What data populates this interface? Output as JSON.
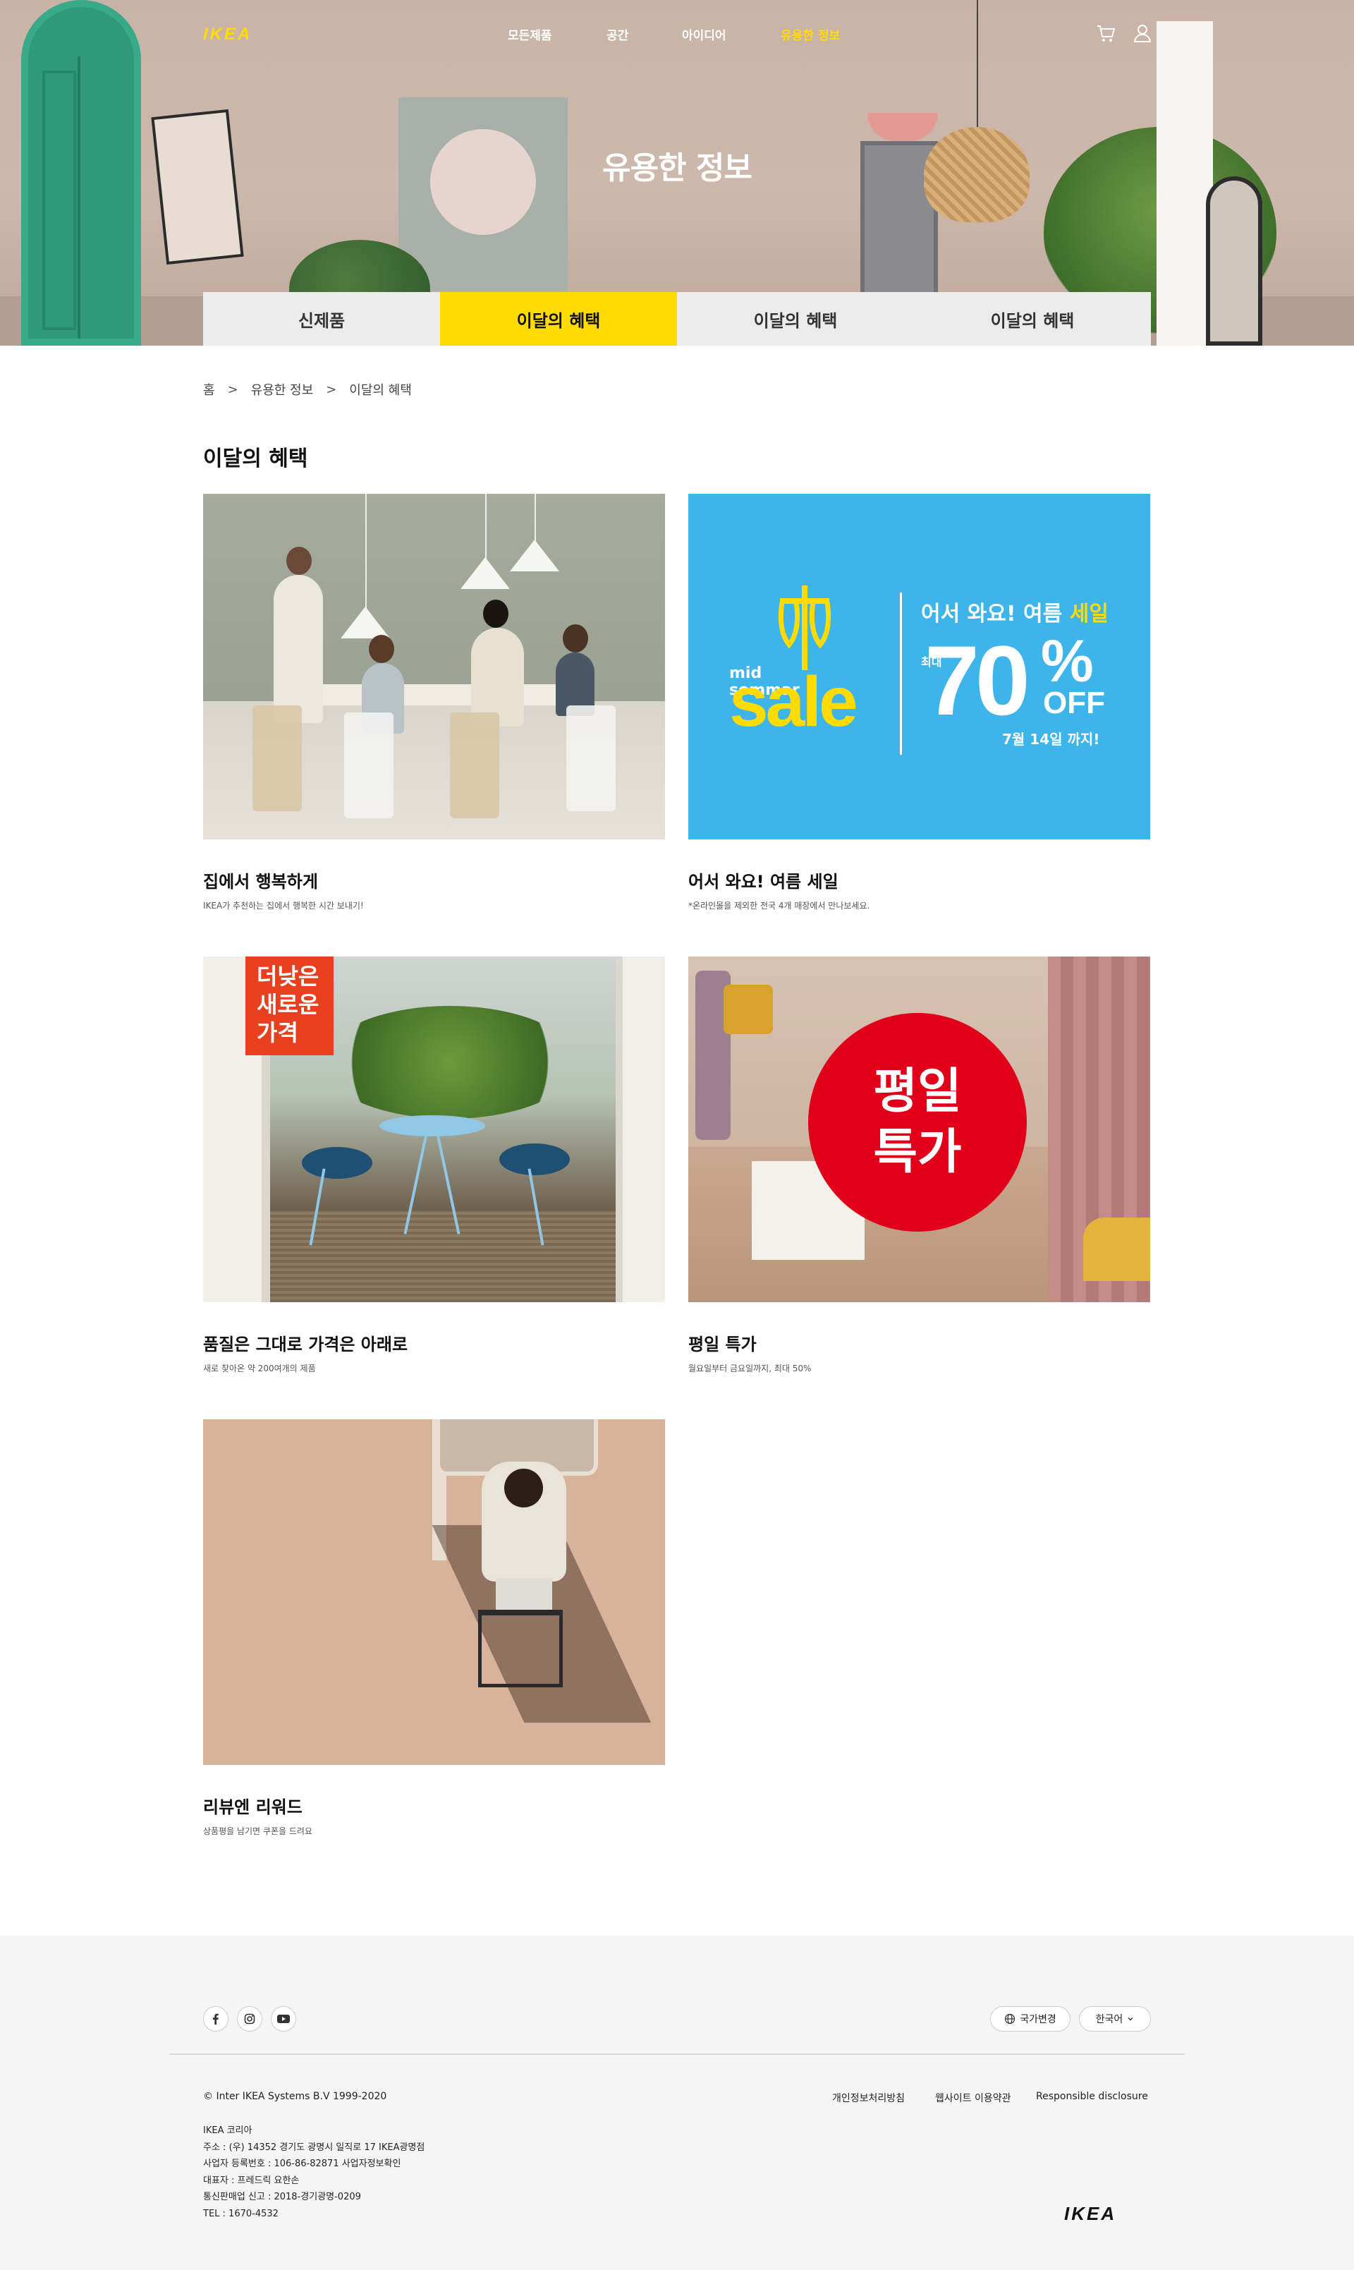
{
  "brand": {
    "logo": "IKEA",
    "accent": "#ffdb00"
  },
  "nav": {
    "items": [
      {
        "label": "모든제품"
      },
      {
        "label": "공간"
      },
      {
        "label": "아이디어"
      },
      {
        "label": "유용한 정보",
        "active": true
      }
    ],
    "icons": [
      "cart-icon",
      "user-icon"
    ]
  },
  "hero": {
    "title": "유용한 정보"
  },
  "tabs": [
    {
      "label": "신제품"
    },
    {
      "label": "이달의 혜택",
      "active": true
    },
    {
      "label": "이달의 혜택"
    },
    {
      "label": "이달의 혜택"
    }
  ],
  "breadcrumb": {
    "home": "홈",
    "sep": ">",
    "level1": "유용한 정보",
    "level2": "이달의 혜택"
  },
  "section": {
    "title": "이달의 혜택"
  },
  "cards": [
    {
      "title": "집에서 행복하게",
      "desc": "IKEA가 추천하는 집에서 행복한 시간 보내기!"
    },
    {
      "title": "어서 와요! 여름 세일",
      "desc": "*온라인몰을 제외한 전국 4개 매장에서 만나보세요.",
      "banner": {
        "mid": "mid",
        "sommar": "sommar",
        "sale": "sale",
        "headline_a": "어서 와요! 여름 ",
        "headline_b": "세일",
        "max": "최대",
        "percent_value": "70",
        "percent_sign": "%",
        "off": "OFF",
        "until": "7월 14일 까지!"
      }
    },
    {
      "title": "품질은 그대로 가격은 아래로",
      "desc": "새로 찾아온 약 200여개의 제품",
      "tag": {
        "line1": "더낮은",
        "line2": "새로운",
        "line3": "가격"
      }
    },
    {
      "title": "평일 특가",
      "desc": "월요일부터 금요일까지, 최대 50%",
      "badge": {
        "line1": "평일",
        "line2": "특가"
      }
    },
    {
      "title": "리뷰엔 리워드",
      "desc": "상품평을 남기면 쿠폰을 드려요"
    }
  ],
  "footer": {
    "social": [
      "facebook-icon",
      "instagram-icon",
      "youtube-icon"
    ],
    "country_label": "국가변경",
    "language_label": "한국어",
    "copyright": "© Inter IKEA Systems B.V 1999-2020",
    "links": [
      "개인정보처리방침",
      "웹사이트 이용약관",
      "Responsible disclosure"
    ],
    "company": {
      "name": "IKEA 코리아",
      "address": "주소 : (우) 14352 경기도 광명시 일직로 17 IKEA광명점",
      "business_no": "사업자 등록번호 : 106-86-82871 사업자정보확인",
      "ceo": "대표자 : 프레드릭 요한손",
      "ecommerce": "통신판매업 신고 : 2018-경기광명-0209",
      "tel": "TEL : 1670-4532"
    },
    "logo": "IKEA"
  }
}
